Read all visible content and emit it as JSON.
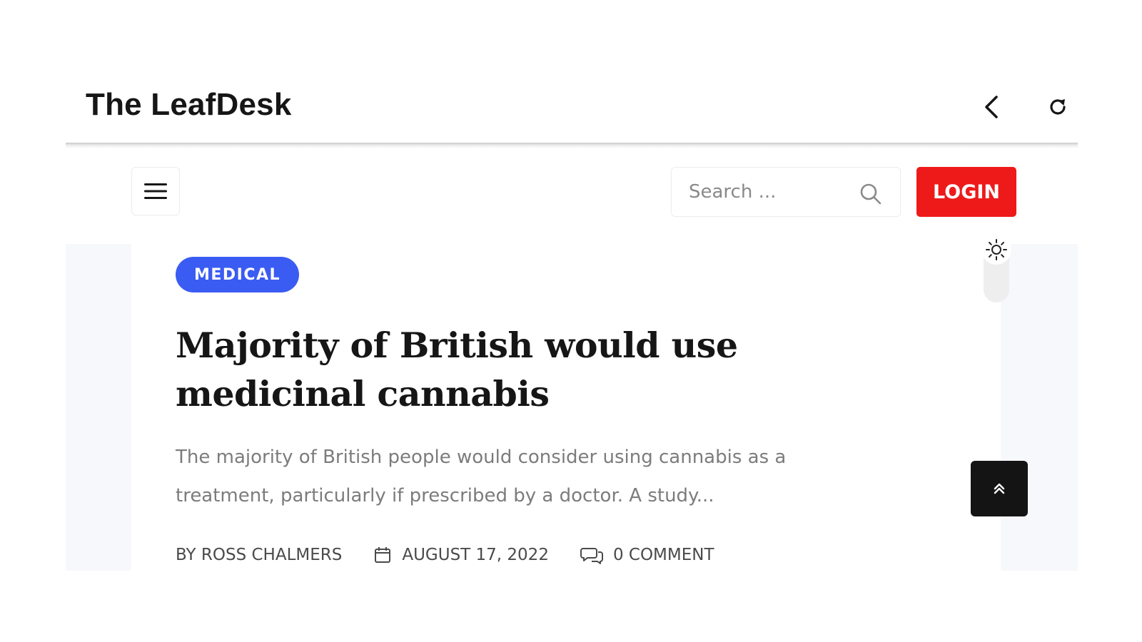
{
  "app_bar": {
    "title": "The LeafDesk",
    "back_icon": "chevron-left-icon",
    "reload_icon": "reload-icon"
  },
  "header": {
    "menu_icon": "hamburger-menu-icon",
    "search": {
      "placeholder": "Search ...",
      "value": "",
      "icon": "search-icon"
    },
    "login_label": "LOGIN"
  },
  "article": {
    "category": "MEDICAL",
    "title": "Majority of British would use medicinal cannabis",
    "excerpt": "The majority of British people would consider using cannabis as a treatment, particularly if prescribed by a doctor. A study...",
    "author": "BY ROSS CHALMERS",
    "date": "AUGUST 17, 2022",
    "comments": "0 COMMENT"
  },
  "theme_toggle": {
    "icon": "sun-icon"
  },
  "scroll_top": {
    "icon": "double-chevron-up-icon"
  },
  "colors": {
    "login": "#ee1a1a",
    "badge": "#3b5cf2",
    "scroll_top": "#141414",
    "content_background": "#f7f8fb"
  }
}
